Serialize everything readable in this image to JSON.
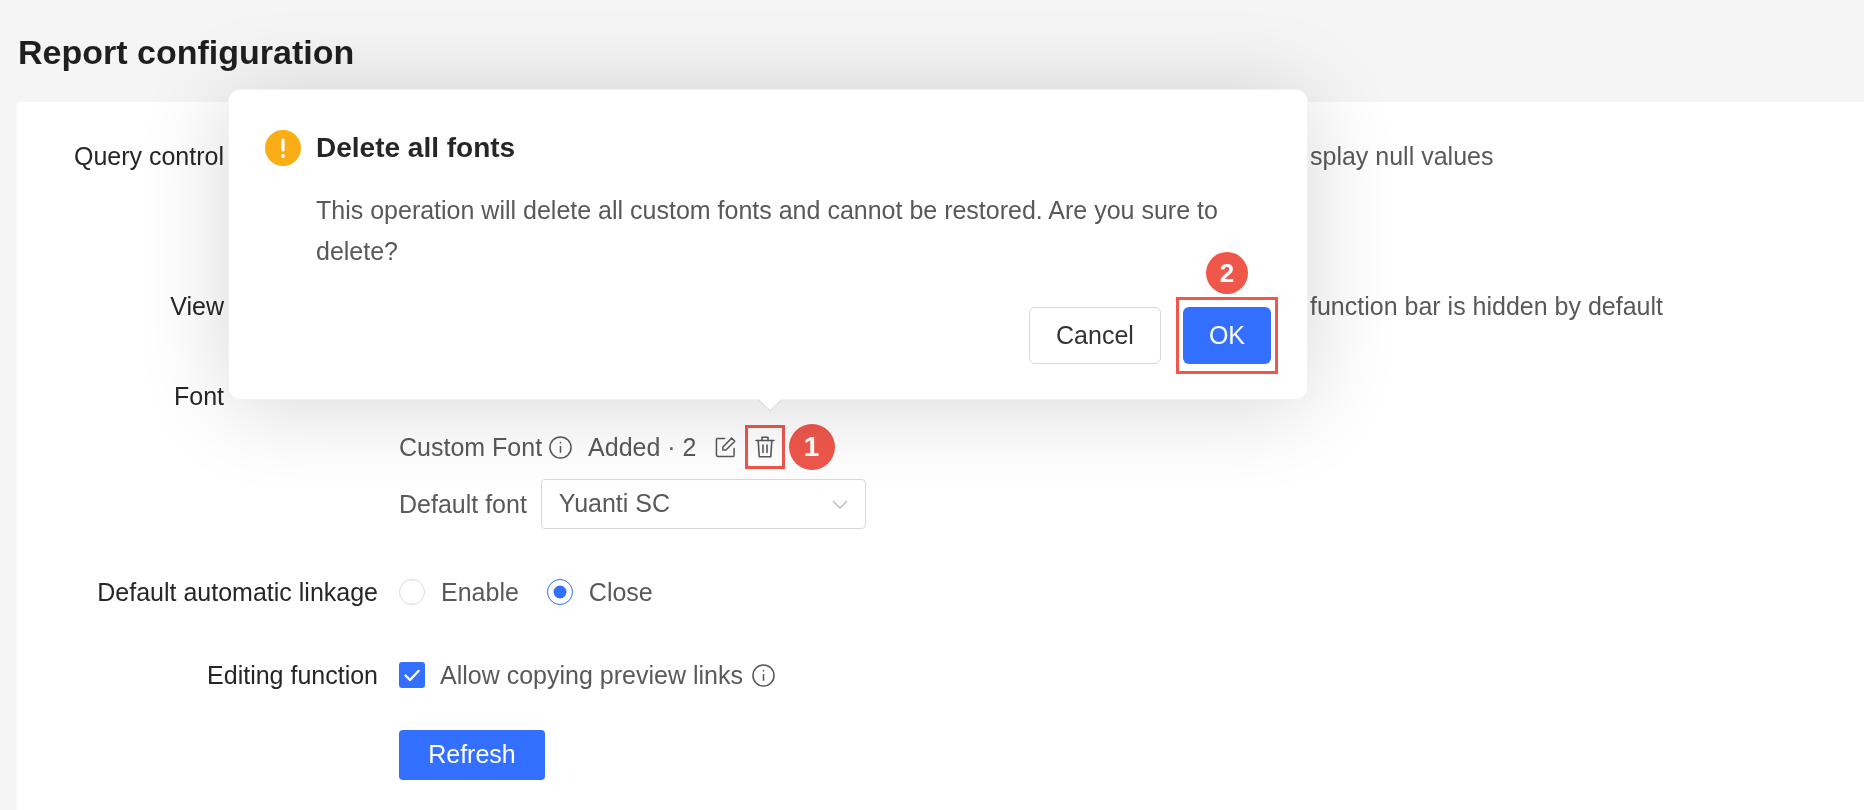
{
  "page": {
    "title": "Report configuration"
  },
  "settings": [
    {
      "kind": "fragment",
      "label": "Query control",
      "trailing_text": "splay null values"
    },
    {
      "kind": "fragment",
      "label": "View",
      "trailing_text": "function bar is hidden by default"
    },
    {
      "kind": "font",
      "label": "Font",
      "custom_font": {
        "label": "Custom Font",
        "status": "Added · 2",
        "delete_highlighted": true,
        "step_badge": "1"
      },
      "default_font": {
        "label": "Default font",
        "value": "Yuanti SC"
      }
    },
    {
      "kind": "radio",
      "label": "Default automatic linkage",
      "options": [
        {
          "label": "Enable",
          "selected": false
        },
        {
          "label": "Close",
          "selected": true
        }
      ]
    },
    {
      "kind": "checkbox",
      "label": "Editing function",
      "checkbox": {
        "label": "Allow copying preview links",
        "checked": true
      }
    }
  ],
  "refresh_button": {
    "label": "Refresh"
  },
  "dialog": {
    "title": "Delete all fonts",
    "message": "This operation will delete all custom fonts and cannot be restored. Are you sure to delete?",
    "buttons": [
      {
        "label": "Cancel",
        "kind": "default"
      },
      {
        "label": "OK",
        "kind": "primary",
        "highlighted": true,
        "step_badge": "2"
      }
    ]
  }
}
